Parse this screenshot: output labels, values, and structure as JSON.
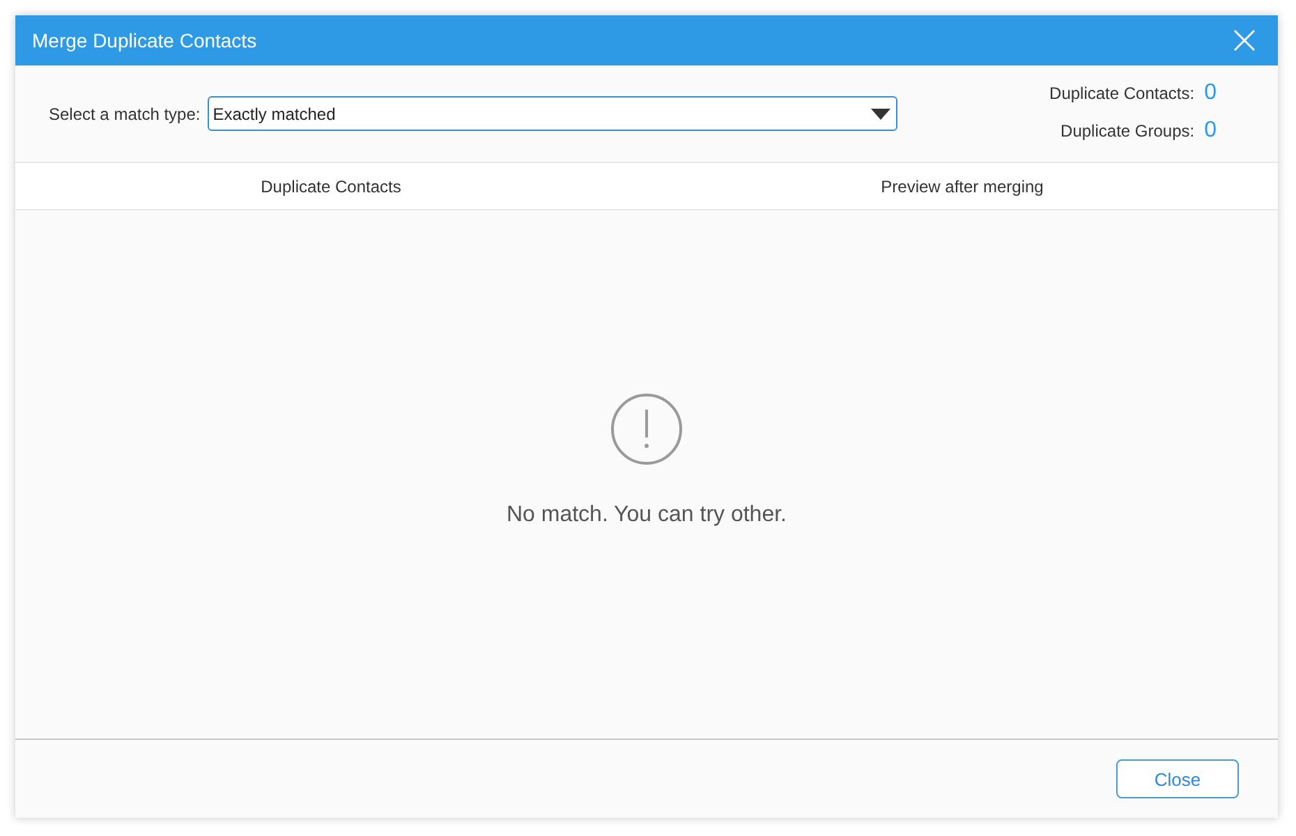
{
  "window": {
    "title": "Merge Duplicate Contacts"
  },
  "match_type": {
    "label": "Select a match type:",
    "value": "Exactly matched"
  },
  "stats": [
    {
      "label": "Duplicate Contacts:",
      "value": "0"
    },
    {
      "label": "Duplicate Groups:",
      "value": "0"
    }
  ],
  "columns": [
    "Duplicate Contacts",
    "Preview after merging"
  ],
  "empty_state": {
    "message": "No match. You can try other."
  },
  "buttons": [
    {
      "label": "Close"
    }
  ]
}
